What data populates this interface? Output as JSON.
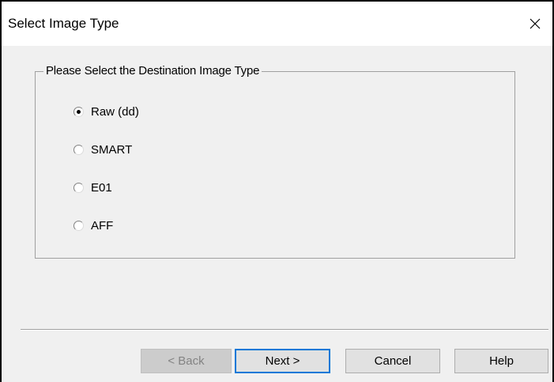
{
  "window": {
    "title": "Select Image Type",
    "close_glyph": "×"
  },
  "group": {
    "legend": "Please Select the Destination Image Type"
  },
  "options": [
    {
      "label": "Raw (dd)",
      "checked": true
    },
    {
      "label": "SMART",
      "checked": false
    },
    {
      "label": "E01",
      "checked": false
    },
    {
      "label": "AFF",
      "checked": false
    }
  ],
  "buttons": {
    "back": "< Back",
    "next": "Next >",
    "cancel": "Cancel",
    "help": "Help"
  },
  "icons": {
    "close": "close-icon"
  }
}
